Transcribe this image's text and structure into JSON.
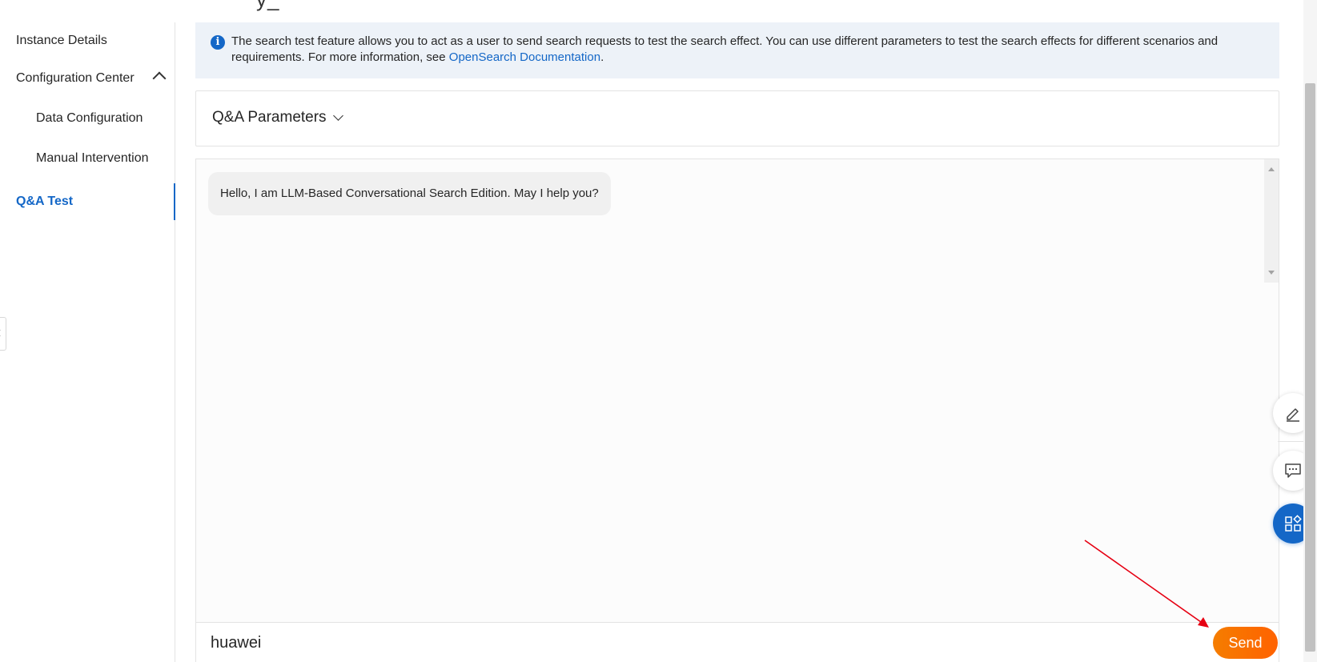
{
  "header": {
    "title_fragment": "y_"
  },
  "sidebar": {
    "items": [
      {
        "label": "Instance Details",
        "level": 1,
        "active": false
      },
      {
        "label": "Configuration Center",
        "level": 1,
        "active": false,
        "expanded": true
      },
      {
        "label": "Data Configuration",
        "level": 2,
        "active": false
      },
      {
        "label": "Manual Intervention",
        "level": 2,
        "active": false
      },
      {
        "label": "Q&A Test",
        "level": 1,
        "active": true
      }
    ]
  },
  "info_banner": {
    "icon": "info-icon",
    "text": "The search test feature allows you to act as a user to send search requests to test the search effect. You can use different parameters to test the search effects for different scenarios and requirements. For more information, see ",
    "link_text": "OpenSearch Documentation",
    "suffix": "."
  },
  "params": {
    "label": "Q&A Parameters"
  },
  "chat": {
    "messages": [
      {
        "role": "assistant",
        "text": "Hello, I am LLM-Based Conversational Search Edition. May I help you?"
      }
    ],
    "input_value": "huawei",
    "send_label": "Send"
  },
  "floating_actions": [
    {
      "icon": "edit-icon"
    },
    {
      "icon": "feedback-chat-icon"
    },
    {
      "icon": "apps-grid-icon",
      "primary": true
    }
  ],
  "colors": {
    "accent": "#1467c7",
    "send_button": "#ff6a00",
    "banner_bg": "#edf2f8",
    "annotation_arrow": "#e60012"
  }
}
